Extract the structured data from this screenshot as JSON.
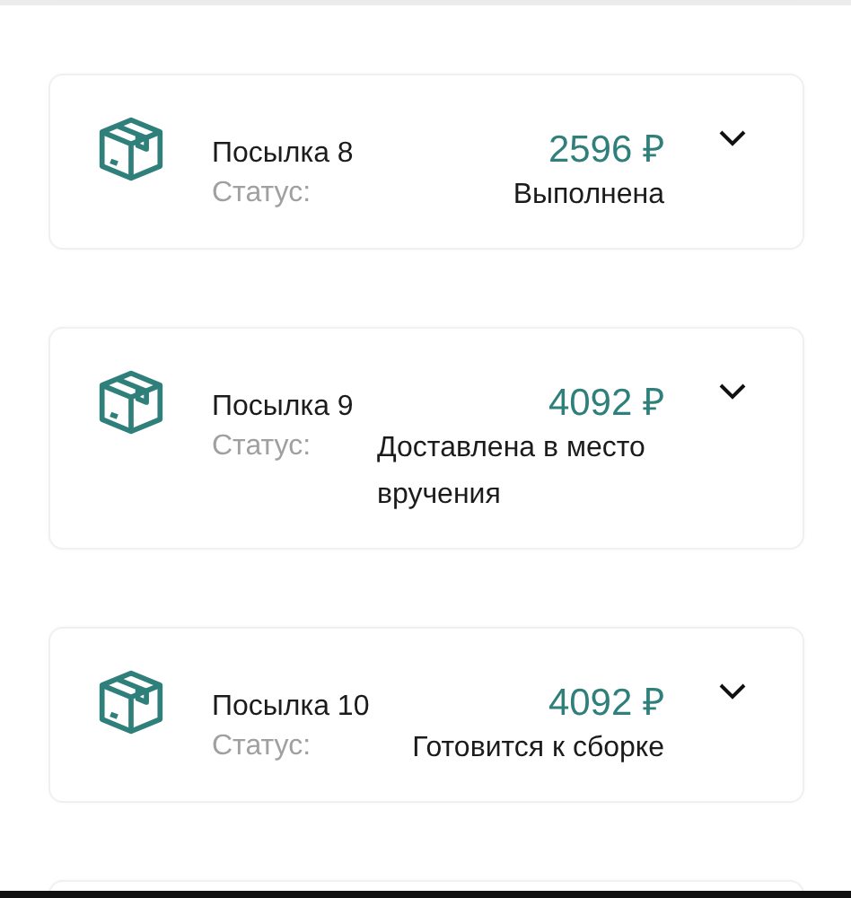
{
  "parcels": [
    {
      "title": "Посылка 8",
      "price": "2596 ₽",
      "status_label": "Статус:",
      "status": "Выполнена",
      "expanded": false
    },
    {
      "title": "Посылка 9",
      "price": "4092 ₽",
      "status_label": "Статус:",
      "status": "Доставлена в место вручения",
      "expanded": false
    },
    {
      "title": "Посылка 10",
      "price": "4092 ₽",
      "status_label": "Статус:",
      "status": "Готовится к сборке",
      "expanded": false
    }
  ]
}
